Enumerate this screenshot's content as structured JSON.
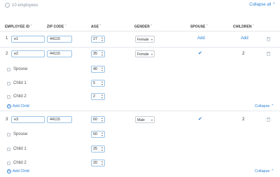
{
  "toolbar": {
    "employee_count": "10 employees",
    "collapse_all": "Collapse all"
  },
  "columns": {
    "employee_id": "EMPLOYEE ID",
    "zip_code": "ZIP CODE",
    "age": "AGE",
    "gender": "GENDER",
    "spouse": "SPOUSE",
    "children": "CHILDREN"
  },
  "rows": [
    {
      "num": "1",
      "id": "e1",
      "zip": "44115",
      "age": "27",
      "gender": "Female",
      "spouse": "Add",
      "children": "Add"
    },
    {
      "num": "2",
      "id": "e2",
      "zip": "44115",
      "age": "35",
      "gender": "Female",
      "children": "2",
      "sub": [
        {
          "label": "Spouse",
          "age": "40"
        },
        {
          "label": "Child 1",
          "age": "5"
        },
        {
          "label": "Child 2",
          "age": "2"
        }
      ],
      "add_child": "Add Child",
      "collapse": "Collapse"
    },
    {
      "num": "3",
      "id": "e3",
      "zip": "44115",
      "age": "60",
      "gender": "Male",
      "children": "2",
      "sub": [
        {
          "label": "Spouse",
          "age": "60"
        },
        {
          "label": "Child 1",
          "age": "25"
        },
        {
          "label": "Child 2",
          "age": "20"
        }
      ],
      "add_child": "Add Child",
      "collapse": "Collapse"
    }
  ],
  "icons": {
    "spouse_present": "checkmark-icon",
    "delete": "trash-icon",
    "count": "users-icon",
    "sub": "person-icon"
  },
  "colors": {
    "accent": "#2a7fd4",
    "divider": "#e4e8ec"
  }
}
